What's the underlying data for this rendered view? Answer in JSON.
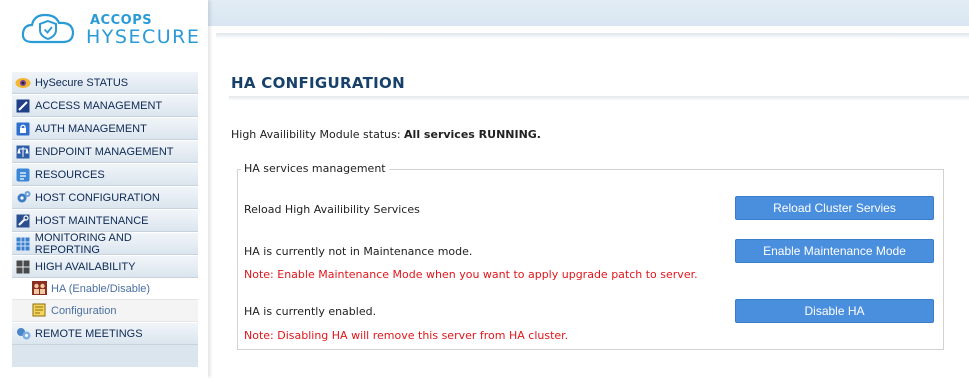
{
  "brand": {
    "company": "ACCOPS",
    "product": "HYSECURE"
  },
  "sidebar": {
    "items": [
      {
        "label": "HySecure STATUS",
        "icon": "eye-status-icon"
      },
      {
        "label": "ACCESS MANAGEMENT",
        "icon": "access-icon"
      },
      {
        "label": "AUTH MANAGEMENT",
        "icon": "lock-icon"
      },
      {
        "label": "ENDPOINT MANAGEMENT",
        "icon": "scale-icon"
      },
      {
        "label": "RESOURCES",
        "icon": "resources-icon"
      },
      {
        "label": "HOST CONFIGURATION",
        "icon": "gears-icon"
      },
      {
        "label": "HOST MAINTENANCE",
        "icon": "wrench-icon"
      },
      {
        "label": "MONITORING AND REPORTING",
        "icon": "grid-icon"
      },
      {
        "label": "HIGH AVAILABILITY",
        "icon": "server-icon"
      },
      {
        "label": "REMOTE MEETINGS",
        "icon": "meetings-icon"
      }
    ],
    "subitems": [
      {
        "label": "HA (Enable/Disable)",
        "icon": "users-icon"
      },
      {
        "label": "Configuration",
        "icon": "note-icon"
      }
    ]
  },
  "main": {
    "title": "HA CONFIGURATION",
    "status_prefix": "High Availibility Module status: ",
    "status_value": "All services RUNNING.",
    "fieldset_legend": "HA services management",
    "rows": {
      "reload_text": "Reload High Availibility Services",
      "reload_button": "Reload Cluster Servies",
      "maintenance_text": "HA is currently not in Maintenance mode.",
      "maintenance_button": "Enable Maintenance Mode",
      "maintenance_note": "Note: Enable Maintenance Mode when you want to apply upgrade patch to server.",
      "enabled_text": "HA is currently enabled.",
      "disable_button": "Disable HA",
      "disable_note": "Note: Disabling HA will remove this server from HA cluster."
    }
  },
  "colors": {
    "accent": "#2a9bd6",
    "button": "#4a8fde",
    "note": "#e0161b",
    "title": "#17406b"
  }
}
